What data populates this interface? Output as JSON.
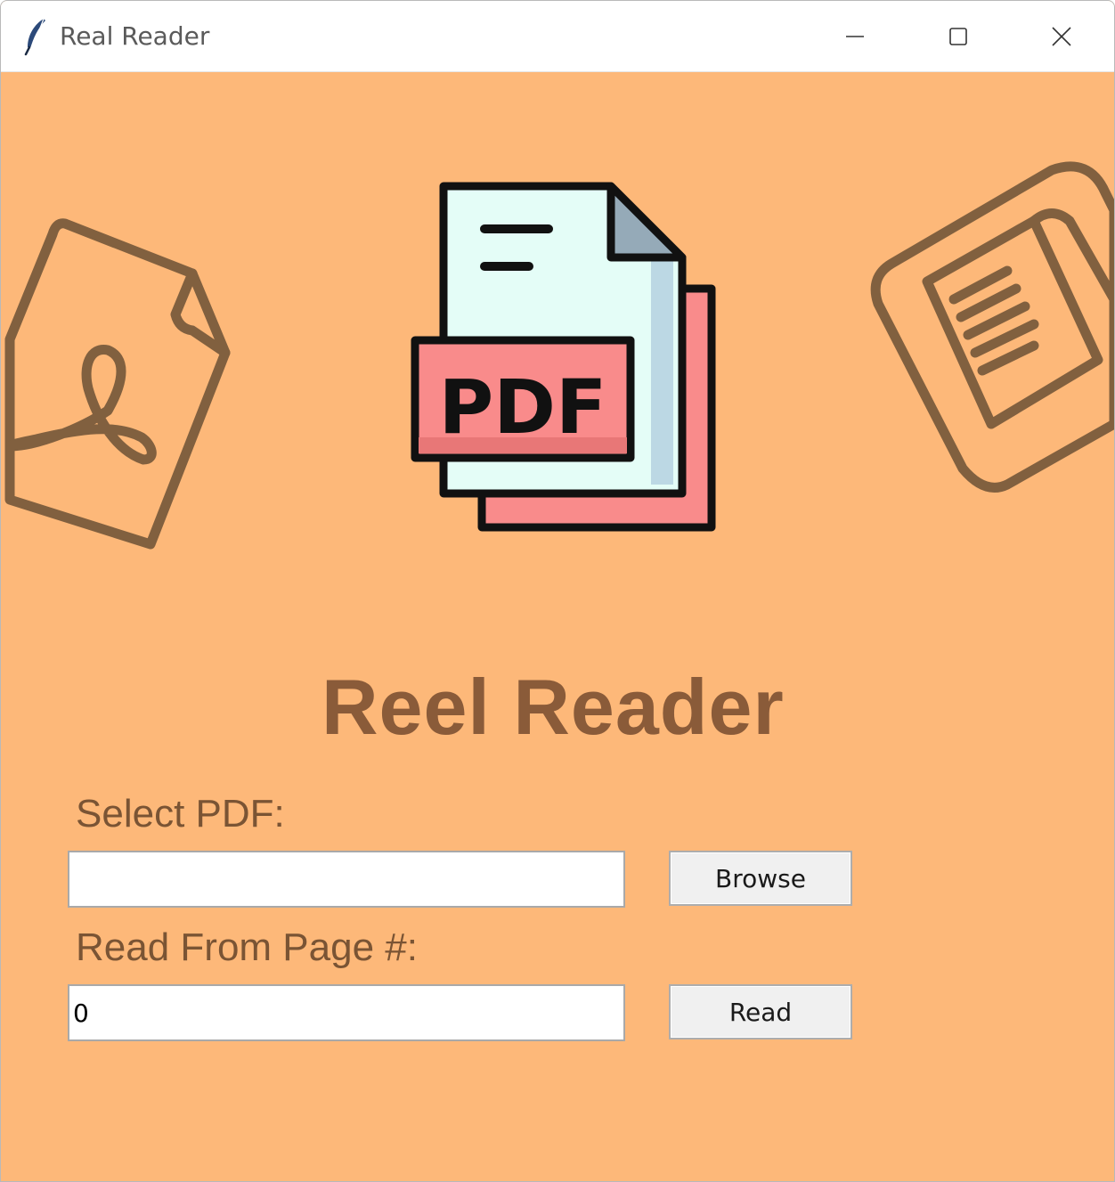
{
  "window": {
    "title": "Real Reader",
    "app_icon": "feather-icon",
    "controls": {
      "minimize": "minimize-icon",
      "maximize": "maximize-icon",
      "close": "close-icon"
    }
  },
  "hero": {
    "title": "Reel Reader",
    "logo_text": "PDF"
  },
  "form": {
    "select_label": "Select PDF:",
    "pdf_path_value": "",
    "browse_label": "Browse",
    "page_label": "Read From Page #:",
    "page_value": "0",
    "read_label": "Read"
  },
  "colors": {
    "background": "#fdb879",
    "accent_brown": "#8a5b39",
    "pdf_badge": "#f98b8b",
    "document_paper": "#e4fdf7"
  },
  "decorations": [
    "acrobat-document-icon",
    "notebook-pen-icon"
  ]
}
